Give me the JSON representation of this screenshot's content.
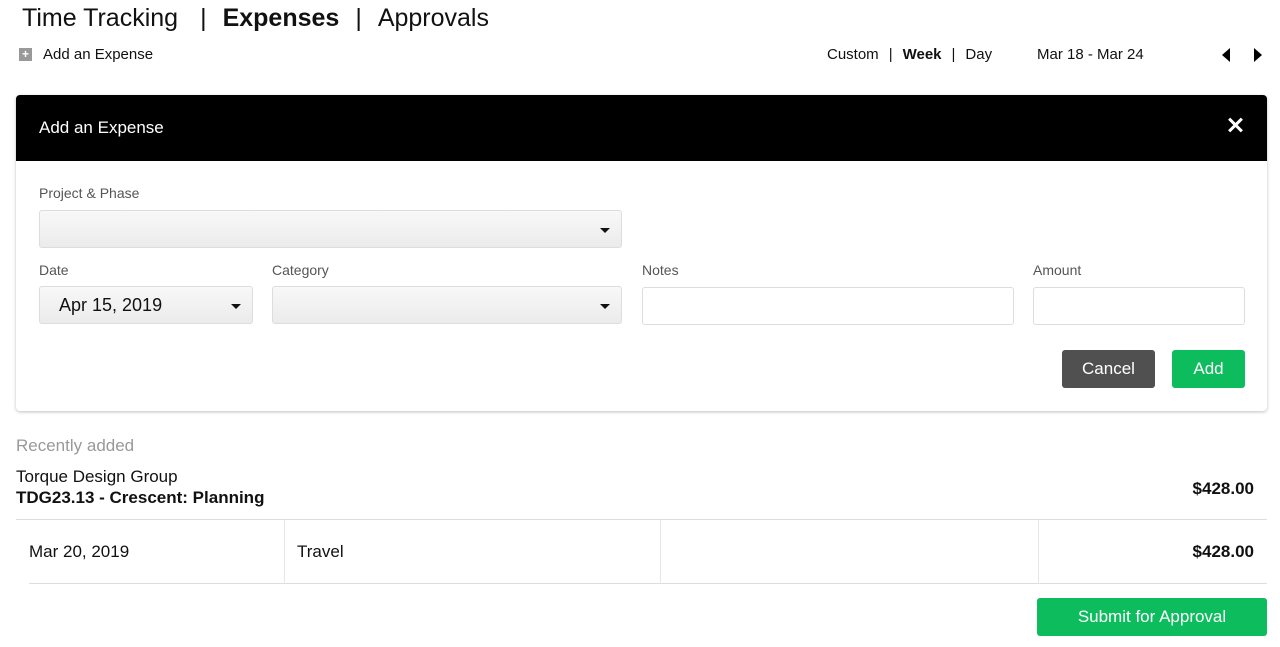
{
  "tabs": [
    {
      "label": "Time Tracking",
      "active": false
    },
    {
      "label": "Expenses",
      "active": true
    },
    {
      "label": "Approvals",
      "active": false
    }
  ],
  "tab_separator": "|",
  "add_expense_link": {
    "icon": "plus-icon",
    "icon_glyph": "+",
    "label": "Add an Expense"
  },
  "range": {
    "options": [
      {
        "label": "Custom",
        "active": false
      },
      {
        "label": "Week",
        "active": true
      },
      {
        "label": "Day",
        "active": false
      }
    ],
    "separator": "|",
    "current": "Mar 18 - Mar 24",
    "prev_icon": "triangle-left-icon",
    "next_icon": "triangle-right-icon"
  },
  "form": {
    "title": "Add an Expense",
    "close_icon": "close-icon",
    "project_phase": {
      "label": "Project & Phase",
      "value": ""
    },
    "date": {
      "label": "Date",
      "value": "Apr 15, 2019"
    },
    "category": {
      "label": "Category",
      "value": ""
    },
    "notes": {
      "label": "Notes",
      "value": "",
      "placeholder": ""
    },
    "amount": {
      "label": "Amount",
      "value": "",
      "placeholder": ""
    },
    "cancel_label": "Cancel",
    "add_label": "Add"
  },
  "recent": {
    "heading": "Recently added",
    "groups": [
      {
        "client": "Torque Design Group",
        "project": "TDG23.13 - Crescent: Planning",
        "total": "$428.00",
        "rows": [
          {
            "date": "Mar 20, 2019",
            "category": "Travel",
            "notes": "",
            "amount": "$428.00"
          }
        ]
      }
    ]
  },
  "submit_label": "Submit for Approval",
  "colors": {
    "accent_green": "#0dbd5d",
    "cancel_gray": "#505050",
    "header_black": "#000000"
  }
}
